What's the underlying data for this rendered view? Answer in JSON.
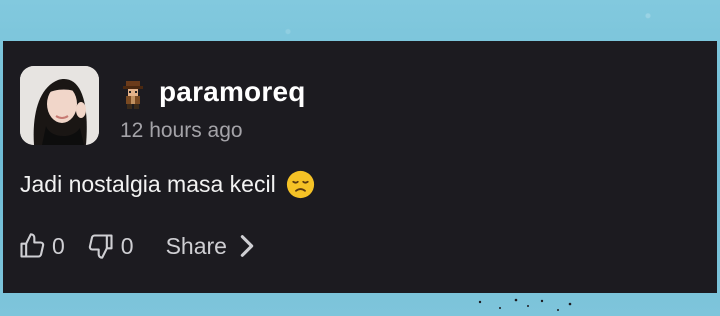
{
  "post": {
    "username": "paramoreq",
    "timestamp": "12 hours ago",
    "message": "Jadi nostalgia masa kecil",
    "emoji": "disappointed-face-icon",
    "likes": "0",
    "dislikes": "0",
    "share_label": "Share"
  },
  "colors": {
    "card_background": "#1c1b20",
    "page_background": "#7cc3da",
    "username": "#ffffff",
    "timestamp": "#a4a3a8",
    "action_text": "#cfcfd3"
  }
}
